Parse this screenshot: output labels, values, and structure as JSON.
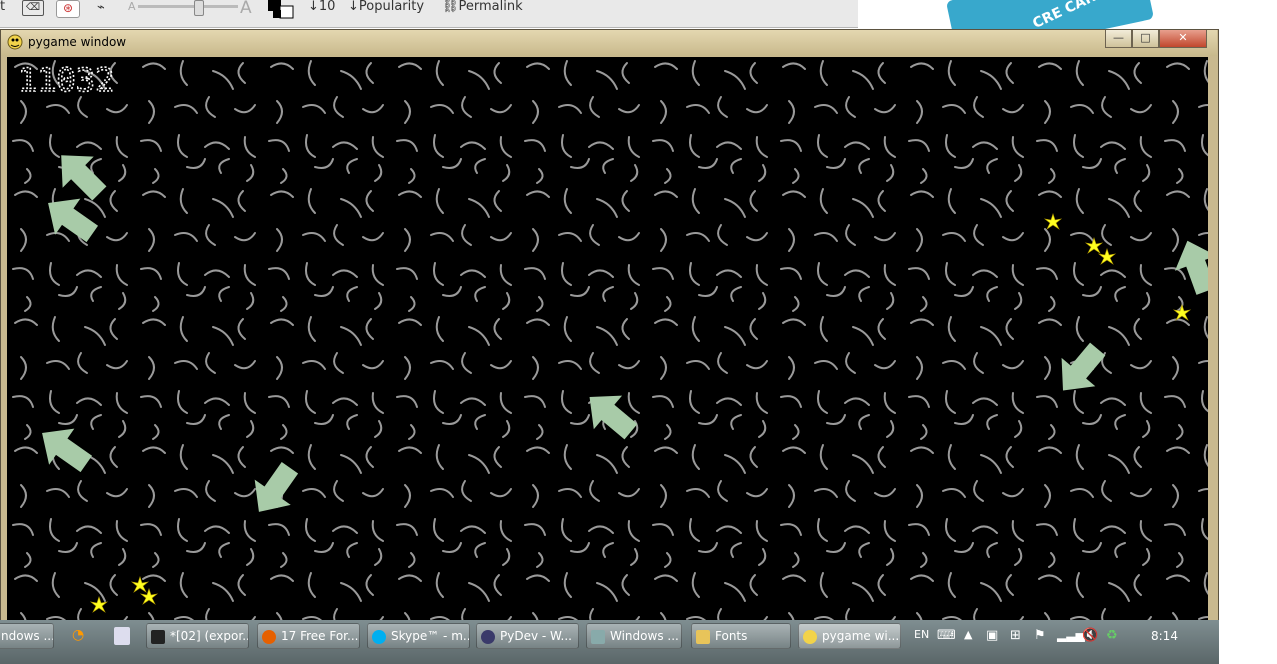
{
  "browser_toolbar": {
    "partial_text": "t",
    "font_size_value": "10",
    "popularity_label": "Popularity",
    "permalink_label": "Permalink",
    "size_small_label": "A",
    "size_large_label": "A",
    "font_slider_level": 0.6
  },
  "ad_banner": {
    "text": "CRE CARD"
  },
  "window": {
    "title": "pygame window",
    "minimize_label": "—",
    "maximize_label": "□",
    "close_label": "✕"
  },
  "game": {
    "score": "11032",
    "background_color": "#000000",
    "arrow_color": "#a8cba8",
    "sparkle_color": "#ffff20"
  },
  "taskbar": {
    "items": [
      {
        "label": "ndows ..."
      },
      {
        "label": "*[02] (expor..."
      },
      {
        "label": "17 Free For..."
      },
      {
        "label": "Skype™ - m..."
      },
      {
        "label": "PyDev - W..."
      },
      {
        "label": "Windows ..."
      },
      {
        "label": "Fonts"
      },
      {
        "label": "pygame wi..."
      }
    ],
    "lang": "EN",
    "clock": "8:14"
  }
}
